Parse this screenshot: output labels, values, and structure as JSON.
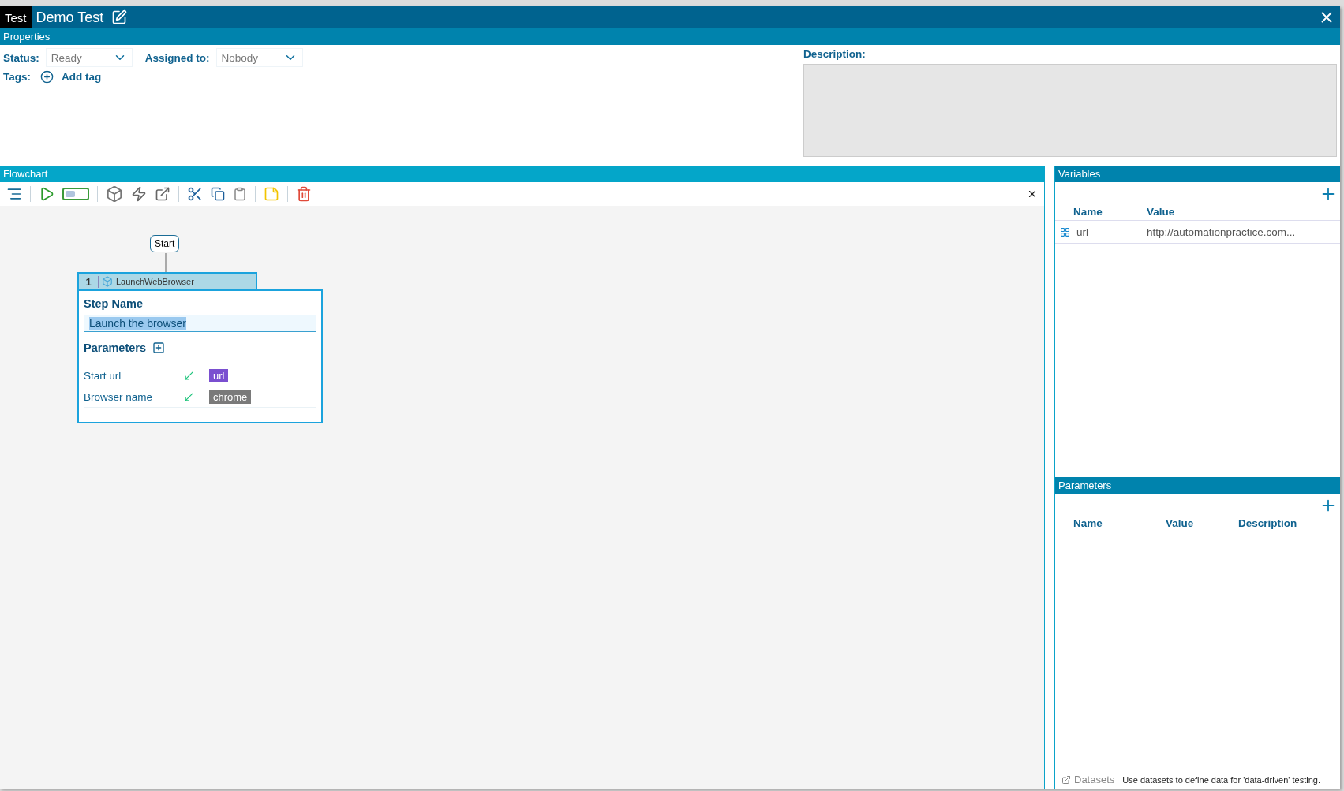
{
  "header": {
    "tab": "Test",
    "title": "Demo Test"
  },
  "properties": {
    "title": "Properties",
    "status": {
      "label": "Status:",
      "value": "Ready"
    },
    "assigned": {
      "label": "Assigned to:",
      "value": "Nobody"
    },
    "tags": {
      "label": "Tags:",
      "action": "Add tag"
    },
    "description": {
      "label": "Description:"
    }
  },
  "flowchart": {
    "title": "Flowchart",
    "start": "Start",
    "step": {
      "number": "1",
      "type": "LaunchWebBrowser",
      "name_label": "Step Name",
      "name_value": "Launch the browser",
      "params_label": "Parameters",
      "params": [
        {
          "name": "Start url",
          "value": "url",
          "kind": "variable"
        },
        {
          "name": "Browser name",
          "value": "chrome",
          "kind": "literal"
        }
      ]
    }
  },
  "variables": {
    "title": "Variables",
    "columns": [
      "Name",
      "Value"
    ],
    "rows": [
      {
        "name": "url",
        "value": "http://automationpractice.com..."
      }
    ]
  },
  "parameters": {
    "title": "Parameters",
    "columns": [
      "Name",
      "Value",
      "Description"
    ]
  },
  "datasets": {
    "link": "Datasets",
    "hint": "Use datasets to define data for 'data-driven' testing."
  }
}
